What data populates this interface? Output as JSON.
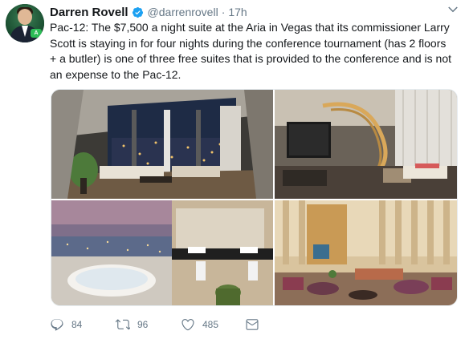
{
  "tweet": {
    "author_name": "Darren Rovell",
    "handle": "@darrenrovell",
    "separator": "·",
    "time": "17h",
    "text": "Pac-12: The $7,500 a night suite at the Aria in Vegas that its commissioner Larry\nScott is staying in for four nights during the conference tournament (has 2 floors\n+ a butler) is one of three free suites that is provided to the conference and is not\nan expense to the Pac-12."
  },
  "actions": {
    "reply_count": "84",
    "retweet_count": "96",
    "like_count": "485"
  },
  "icons": {
    "verified": "verified-badge-icon",
    "caret": "chevron-down-icon",
    "reply": "reply-icon",
    "retweet": "retweet-icon",
    "like": "heart-icon",
    "dm": "envelope-icon"
  },
  "colors": {
    "text": "#14171a",
    "secondary": "#657786",
    "verified": "#1da1f2"
  }
}
